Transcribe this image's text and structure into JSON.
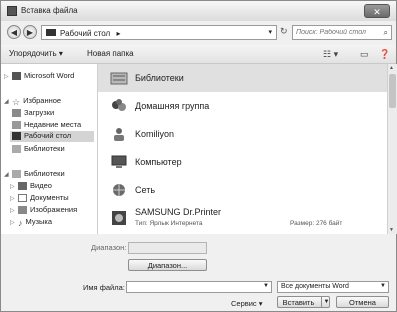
{
  "window": {
    "title": "Вставка файла",
    "close_label": "✕"
  },
  "address": {
    "folder": "Рабочий стол",
    "separator": "▸",
    "search_placeholder": "Поиск: Рабочий стол"
  },
  "toolbar": {
    "organize": "Упорядочить ▾",
    "new_folder": "Новая папка"
  },
  "nav": {
    "microsoft_word": "Microsoft Word",
    "favorites": "Избранное",
    "downloads": "Загрузки",
    "recent": "Недавние места",
    "desktop": "Рабочий стол",
    "libraries_fav": "Библиотеки",
    "libraries": "Библиотеки",
    "video": "Видео",
    "documents": "Документы",
    "images": "Изображения",
    "music": "Музыка"
  },
  "files": [
    {
      "name": "Библиотеки"
    },
    {
      "name": "Домашняя группа"
    },
    {
      "name": "Komiliyon"
    },
    {
      "name": "Компьютер"
    },
    {
      "name": "Сеть"
    },
    {
      "name": "SAMSUNG Dr.Printer",
      "type_label": "Тип: Ярлык Интернета",
      "size_label": "Размер: 276 байт"
    }
  ],
  "bottom": {
    "range_label": "Диапазон:",
    "range_button": "Диапазон...",
    "filename_label": "Имя файла:",
    "filetype_value": "Все документы Word",
    "service": "Сервис",
    "insert": "Вставить",
    "cancel": "Отмена"
  }
}
